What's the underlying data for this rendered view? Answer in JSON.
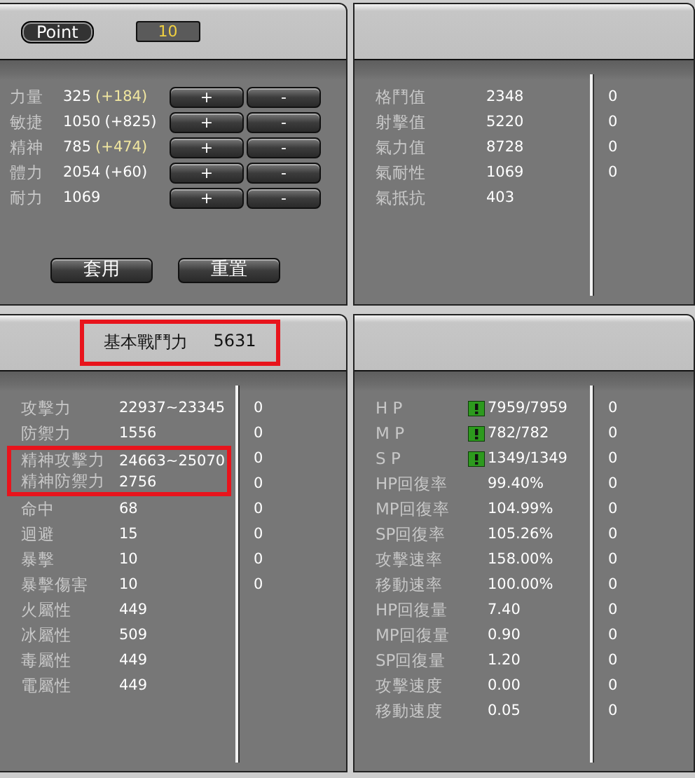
{
  "attribute_panel": {
    "point_label": "Point",
    "points": "10",
    "stats": [
      {
        "label": "力量",
        "value": "325",
        "bonus": "(+184)",
        "color": "#f0e6a0",
        "plus": "+",
        "minus": "-"
      },
      {
        "label": "敏捷",
        "value": "1050",
        "bonus": "(+825)",
        "color": "#ffffff",
        "plus": "+",
        "minus": "-"
      },
      {
        "label": "精神",
        "value": "785",
        "bonus": "(+474)",
        "color": "#f0e6a0",
        "plus": "+",
        "minus": "-"
      },
      {
        "label": "體力",
        "value": "2054",
        "bonus": "(+60)",
        "color": "#ffffff",
        "plus": "+",
        "minus": "-"
      },
      {
        "label": "耐力",
        "value": "1069",
        "plus": "+",
        "minus": "-"
      }
    ],
    "buttons": [
      "套用",
      "重置"
    ]
  },
  "element_panel": {
    "rows": [
      {
        "label": "格鬥值",
        "value": "2348",
        "extra": "0"
      },
      {
        "label": "射擊值",
        "value": "5220",
        "extra": "0"
      },
      {
        "label": "氣力值",
        "value": "8728",
        "extra": "0"
      },
      {
        "label": "氣耐性",
        "value": "1069",
        "extra": "0"
      },
      {
        "label": "氣抵抗",
        "value": "403"
      }
    ]
  },
  "combat_panel": {
    "title": "基本戰鬥力",
    "power": "5631",
    "highlighted": true,
    "rows": [
      {
        "label": "攻擊力",
        "value": "22937~23345",
        "extra": "0",
        "highlighted": false
      },
      {
        "label": "防禦力",
        "value": "1556",
        "extra": "0",
        "highlighted": false
      },
      {
        "label": "精神攻擊力",
        "value": "24663~25070",
        "extra": "0",
        "highlighted": true
      },
      {
        "label": "精神防禦力",
        "value": "2756",
        "extra": "0",
        "highlighted": true
      },
      {
        "label": "命中",
        "value": "68",
        "extra": "0",
        "highlighted": false
      },
      {
        "label": "迴避",
        "value": "15",
        "extra": "0",
        "highlighted": false
      },
      {
        "label": "暴擊",
        "value": "10",
        "extra": "0",
        "highlighted": false
      },
      {
        "label": "暴擊傷害",
        "value": "10",
        "extra": "0",
        "highlighted": false
      },
      {
        "label": "火屬性",
        "value": "449",
        "highlighted": false
      },
      {
        "label": "冰屬性",
        "value": "509",
        "highlighted": false
      },
      {
        "label": "毒屬性",
        "value": "449",
        "highlighted": false
      },
      {
        "label": "電屬性",
        "value": "449",
        "highlighted": false
      }
    ]
  },
  "vitals_panel": {
    "rows": [
      {
        "kind": "gauge",
        "label": "H P",
        "value": "7959/7959",
        "extra": "0"
      },
      {
        "kind": "gauge",
        "label": "M P",
        "value": "782/782",
        "extra": "0"
      },
      {
        "kind": "gauge",
        "label": "S P",
        "value": "1349/1349",
        "extra": "0"
      },
      {
        "kind": "plain",
        "label": "HP回復率",
        "value": "99.40%",
        "extra": "0"
      },
      {
        "kind": "plain",
        "label": "MP回復率",
        "value": "104.99%",
        "extra": "0"
      },
      {
        "kind": "plain",
        "label": "SP回復率",
        "value": "105.26%",
        "extra": "0"
      },
      {
        "kind": "plain",
        "label": "攻擊速率",
        "value": "158.00%",
        "extra": "0"
      },
      {
        "kind": "plain",
        "label": "移動速率",
        "value": "100.00%",
        "extra": "0"
      },
      {
        "kind": "plain",
        "label": "HP回復量",
        "value": "7.40",
        "extra": "0"
      },
      {
        "kind": "plain",
        "label": "MP回復量",
        "value": "0.90",
        "extra": "0"
      },
      {
        "kind": "plain",
        "label": "SP回復量",
        "value": "1.20",
        "extra": "0"
      },
      {
        "kind": "plain",
        "label": "攻擊速度",
        "value": "0.00",
        "extra": "0"
      },
      {
        "kind": "plain",
        "label": "移動速度",
        "value": "0.05",
        "extra": "0"
      }
    ]
  }
}
